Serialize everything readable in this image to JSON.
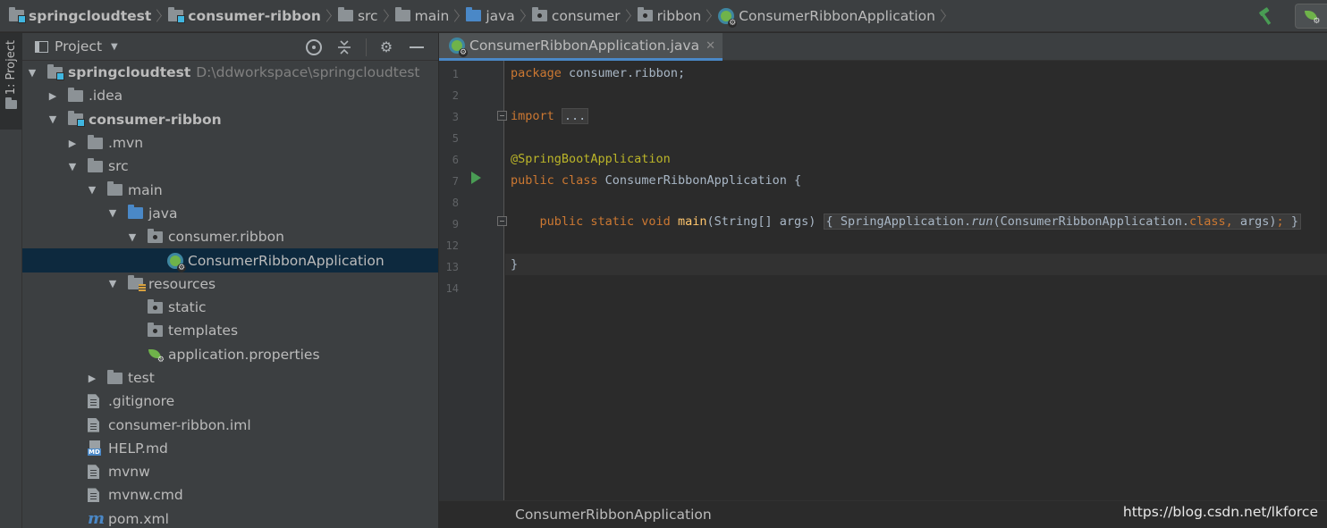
{
  "breadcrumbs": [
    {
      "label": "springcloudtest",
      "icon": "module-folder-icon",
      "bold": true
    },
    {
      "label": "consumer-ribbon",
      "icon": "module-folder-icon",
      "bold": true
    },
    {
      "label": "src",
      "icon": "folder-icon"
    },
    {
      "label": "main",
      "icon": "folder-icon"
    },
    {
      "label": "java",
      "icon": "source-folder-icon"
    },
    {
      "label": "consumer",
      "icon": "package-icon"
    },
    {
      "label": "ribbon",
      "icon": "package-icon"
    },
    {
      "label": "ConsumerRibbonApplication",
      "icon": "spring-boot-class-icon"
    }
  ],
  "toolbar": {
    "build_icon": "hammer-icon",
    "run_config_icon": "spring-boot-run-icon"
  },
  "side_stripe": {
    "label": "1: Project"
  },
  "project_panel": {
    "title": "Project",
    "tools": [
      "locate-icon",
      "collapse-all-icon",
      "settings-icon",
      "hide-icon"
    ],
    "tree": [
      {
        "label": "springcloudtest",
        "path": "D:\\ddworkspace\\springcloudtest",
        "expanded": true,
        "bold": true,
        "icon": "module-folder-icon"
      },
      {
        "label": ".idea",
        "expanded": false,
        "icon": "folder-icon"
      },
      {
        "label": "consumer-ribbon",
        "expanded": true,
        "bold": true,
        "icon": "module-folder-icon"
      },
      {
        "label": ".mvn",
        "expanded": false,
        "icon": "folder-icon"
      },
      {
        "label": "src",
        "expanded": true,
        "icon": "folder-icon"
      },
      {
        "label": "main",
        "expanded": true,
        "icon": "folder-icon"
      },
      {
        "label": "java",
        "expanded": true,
        "icon": "source-folder-icon"
      },
      {
        "label": "consumer.ribbon",
        "expanded": true,
        "icon": "package-icon"
      },
      {
        "label": "ConsumerRibbonApplication",
        "selected": true,
        "icon": "spring-boot-class-icon"
      },
      {
        "label": "resources",
        "expanded": true,
        "icon": "resources-folder-icon"
      },
      {
        "label": "static",
        "icon": "package-icon"
      },
      {
        "label": "templates",
        "icon": "package-icon"
      },
      {
        "label": "application.properties",
        "icon": "spring-properties-icon"
      },
      {
        "label": "test",
        "expanded": false,
        "icon": "folder-icon"
      },
      {
        "label": ".gitignore",
        "icon": "text-file-icon"
      },
      {
        "label": "consumer-ribbon.iml",
        "icon": "iml-file-icon"
      },
      {
        "label": "HELP.md",
        "icon": "markdown-file-icon"
      },
      {
        "label": "mvnw",
        "icon": "text-file-icon"
      },
      {
        "label": "mvnw.cmd",
        "icon": "text-file-icon"
      },
      {
        "label": "pom.xml",
        "icon": "maven-icon"
      }
    ]
  },
  "editor": {
    "tab_label": "ConsumerRibbonApplication.java",
    "line_numbers": [
      "1",
      "2",
      "3",
      "5",
      "6",
      "7",
      "8",
      "9",
      "12",
      "13",
      "14"
    ],
    "code": {
      "l1_kw": "package",
      "l1_rest": " consumer.ribbon;",
      "l3_kw": "import",
      "l3_fold": "...",
      "l6_ann": "@SpringBootApplication",
      "l7_kw": "public class",
      "l7_rest": " ConsumerRibbonApplication {",
      "l9_kw": "public static void",
      "l9_fn": "main",
      "l9_params": "(String[] args)",
      "l9_body_open": "{",
      "l9_call": "SpringApplication.",
      "l9_run": "run",
      "l9_args": "(ConsumerRibbonApplication.",
      "l9_class": "class",
      "l9_comma": ",",
      "l9_args2": " args)",
      "l9_semi": ";",
      "l9_body_close": "}",
      "l13": "}"
    },
    "bottom_breadcrumb": "ConsumerRibbonApplication"
  },
  "watermark": "https://blog.csdn.net/lkforce",
  "colors": {
    "accent": "#4a88c7",
    "selection": "#0d293e",
    "keyword": "#cc7832",
    "annotation": "#bbb529",
    "method": "#ffc66d",
    "text": "#a9b7c6"
  }
}
